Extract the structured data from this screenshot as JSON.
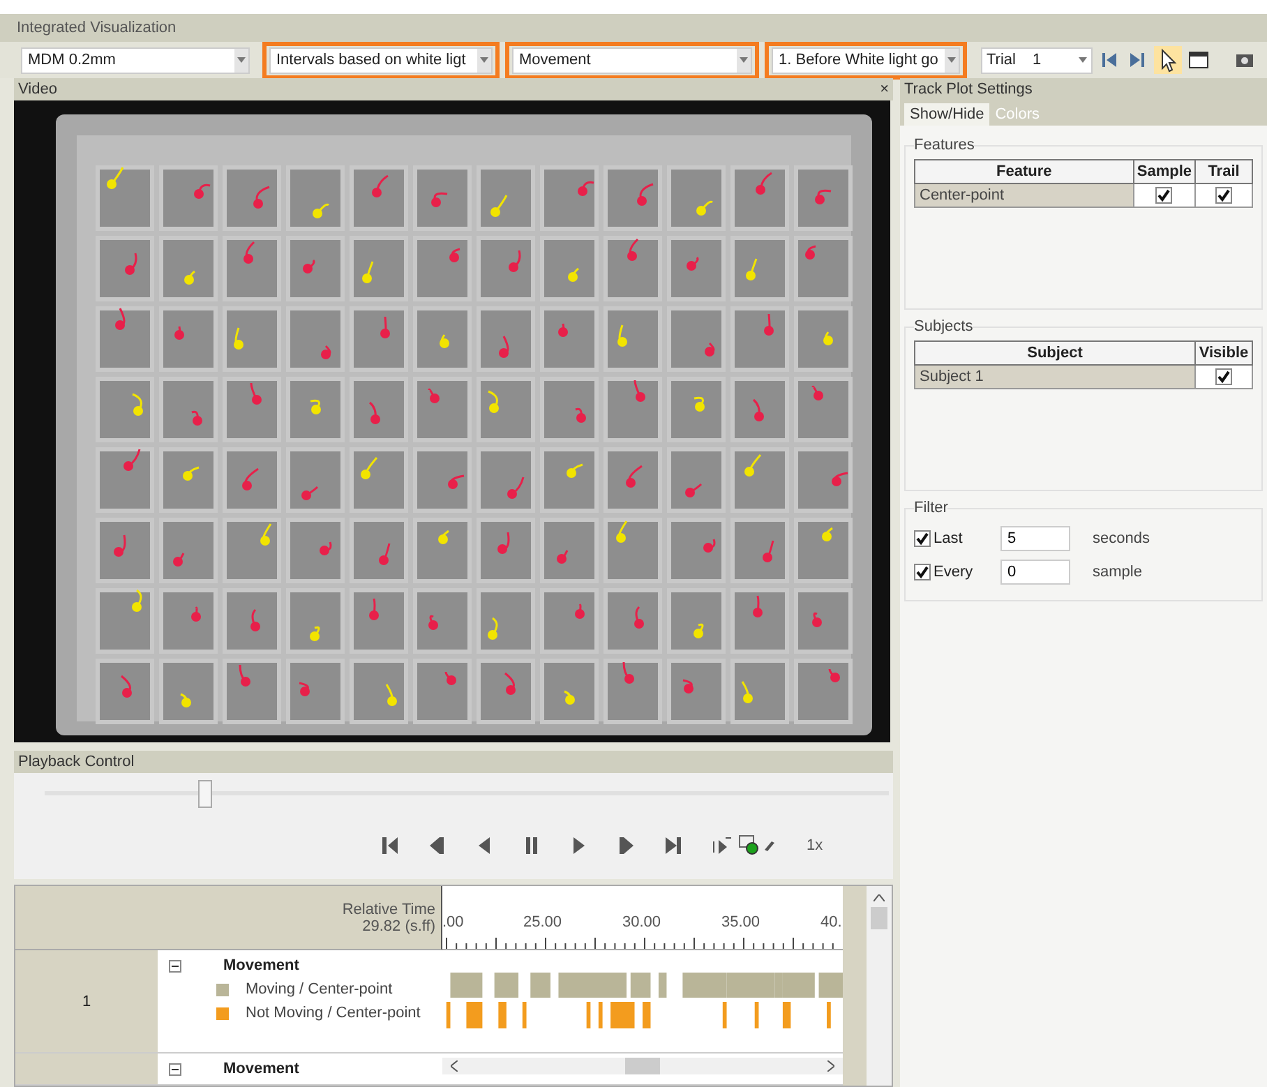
{
  "window": {
    "title": "Integrated Visualization"
  },
  "toolbar": {
    "dropdowns": [
      {
        "value": "MDM 0.2mm",
        "highlighted": false
      },
      {
        "value": "Intervals based on white ligt",
        "highlighted": true
      },
      {
        "value": "Movement",
        "highlighted": true
      },
      {
        "value": "1. Before White light go",
        "highlighted": true
      }
    ],
    "trial": {
      "label": "Trial",
      "value": "1"
    }
  },
  "video_panel": {
    "title": "Video",
    "close": "×"
  },
  "track_plot_settings": {
    "title": "Track Plot Settings",
    "tabs": [
      {
        "label": "Show/Hide",
        "selected": true
      },
      {
        "label": "Colors",
        "selected": false
      }
    ],
    "features": {
      "title": "Features",
      "columns": [
        "Feature",
        "Sample",
        "Trail"
      ],
      "rows": [
        {
          "name": "Center-point",
          "sample": true,
          "trail": true
        }
      ]
    },
    "subjects": {
      "title": "Subjects",
      "columns": [
        "Subject",
        "Visible"
      ],
      "rows": [
        {
          "name": "Subject 1",
          "visible": true
        }
      ]
    },
    "filter": {
      "title": "Filter",
      "rows": [
        {
          "checked": true,
          "label": "Last",
          "value": "5",
          "unit": "seconds"
        },
        {
          "checked": true,
          "label": "Every",
          "value": "0",
          "unit": "sample"
        }
      ]
    }
  },
  "playback": {
    "title": "Playback Control",
    "level": 0.19,
    "speed": "1x"
  },
  "timeline": {
    "header_label": "Relative Time",
    "current_time": "29.82 (s.ff)",
    "ticks": [
      ".00",
      "25.00",
      "30.00",
      "35.00",
      "40."
    ],
    "rows": [
      {
        "number": "1",
        "expanded": true,
        "group": "Movement",
        "legend": [
          {
            "label": "Moving / Center-point",
            "color": "#b9b598"
          },
          {
            "label": "Not Moving / Center-point",
            "color": "#f39c1e"
          }
        ]
      },
      {
        "expanded": true,
        "group": "Movement"
      }
    ]
  }
}
